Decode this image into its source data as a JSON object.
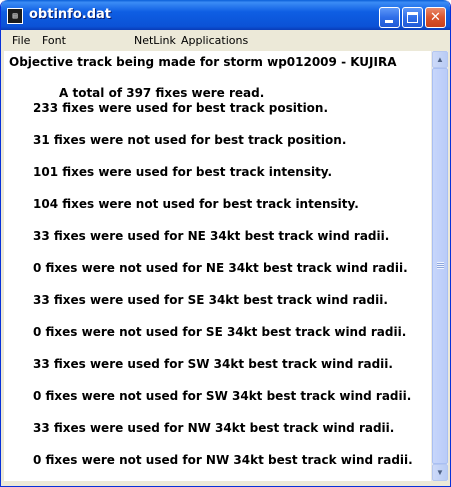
{
  "window": {
    "title": "obtinfo.dat",
    "icon": "app-window-icon",
    "buttons": {
      "minimize": "minimize-icon",
      "maximize": "maximize-icon",
      "close_glyph": "✕"
    }
  },
  "menu": {
    "items": [
      "File",
      "Font",
      "NetLink",
      "Applications"
    ]
  },
  "content": {
    "lines": [
      "Objective track being made for storm wp012009 - KUJIRA",
      "A total of 397 fixes were read.",
      "233 fixes were used for best track position.",
      "31 fixes were not used for best track position.",
      "101 fixes were used for best track intensity.",
      "104 fixes were not used for best track intensity.",
      "33 fixes were used for NE 34kt best track wind radii.",
      "0 fixes were not used for NE 34kt best track wind radii.",
      "33 fixes were used for SE 34kt best track wind radii.",
      "0 fixes were not used for SE 34kt best track wind radii.",
      "33 fixes were used for SW 34kt best track wind radii.",
      "0 fixes were not used for SW 34kt best track wind radii.",
      "33 fixes were used for NW 34kt best track wind radii.",
      "0 fixes were not used for NW 34kt best track wind radii."
    ]
  },
  "scrollbar": {
    "up_glyph": "▲",
    "down_glyph": "▼"
  },
  "colors": {
    "titlebar": "#0b52d6",
    "close_button": "#d9552e",
    "menubar": "#ece9d8",
    "content_bg": "#ffffff"
  }
}
